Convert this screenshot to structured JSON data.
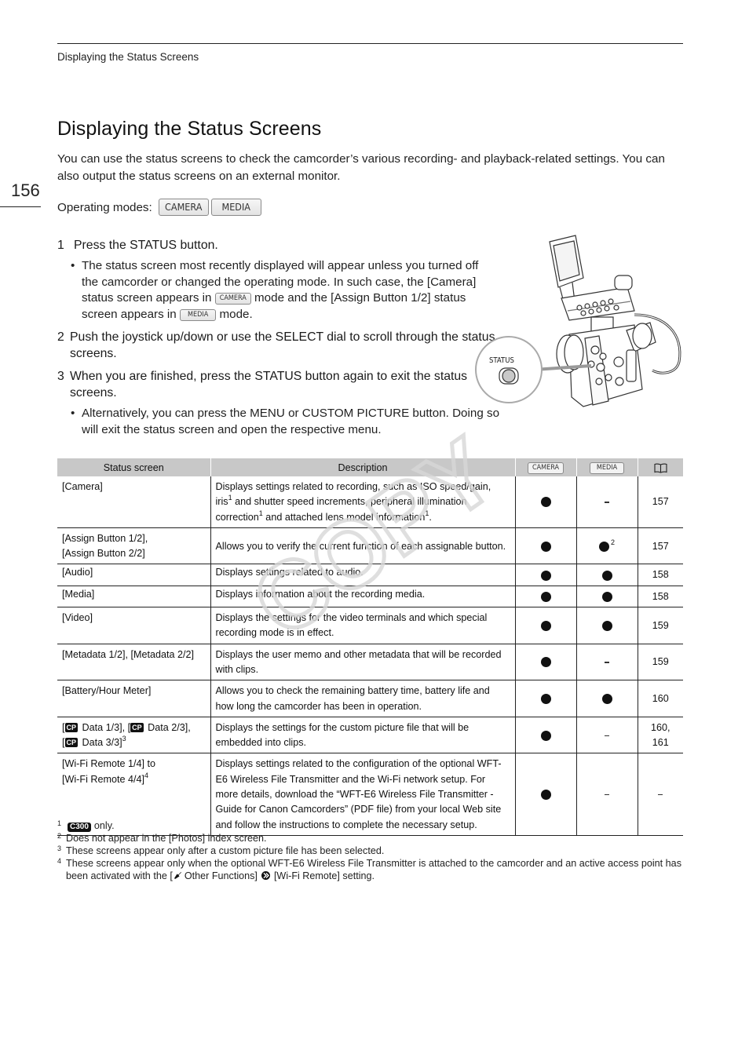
{
  "running_head": "Displaying the Status Screens",
  "page_number": "156",
  "title": "Displaying the Status Screens",
  "intro": "You can use the status screens to check the camcorder’s various recording- and playback-related settings. You can also output the status screens on an external monitor.",
  "operating_modes": {
    "label": "Operating modes:",
    "modes": [
      "CAMERA",
      "MEDIA"
    ]
  },
  "steps": [
    {
      "number": "1",
      "text": "Press the STATUS button.",
      "bullet": {
        "part1": "The status screen most recently displayed will appear unless you turned off the camcorder or changed the operating mode. In such case, the [Camera] status screen appears in",
        "mode1": "CAMERA",
        "part2": "mode and the [Assign Button 1/2] status screen appears in",
        "mode2": "MEDIA",
        "part3": "mode."
      }
    },
    {
      "number": "2",
      "text": "Push the joystick up/down or use the SELECT dial to scroll through the status screens."
    },
    {
      "number": "3",
      "text": "When you are finished, press the STATUS button again to exit the status screens.",
      "bullet": {
        "text": "Alternatively, you can press the MENU or CUSTOM PICTURE button. Doing so will exit the status screen and open the respective menu."
      }
    }
  ],
  "illustration": {
    "callout_label": "STATUS"
  },
  "table": {
    "headers": {
      "status_screen": "Status screen",
      "description": "Description",
      "camera": "CAMERA",
      "media": "MEDIA",
      "page_icon": "book-icon"
    },
    "rows": [
      {
        "screen": "[Camera]",
        "desc_a": "Displays settings related to recording, such as ISO speed/gain, iris",
        "sup_a": "1",
        "desc_b": " and shutter speed increments, peripheral illumination correction",
        "sup_b": "1",
        "desc_c": " and attached lens model information",
        "sup_c": "1",
        "desc_d": ".",
        "camera": "dot",
        "media": "dash",
        "page": "157"
      },
      {
        "screen_line1": "[Assign Button 1/2],",
        "screen_line2": "[Assign Button 2/2]",
        "desc": "Allows you to verify the current function of each assignable button.",
        "camera": "dot",
        "media": "dot",
        "media_sup": "2",
        "page": "157"
      },
      {
        "screen": "[Audio]",
        "desc": "Displays settings related to audio.",
        "camera": "dot",
        "media": "dot",
        "page": "158"
      },
      {
        "screen": "[Media]",
        "desc": "Displays information about the recording media.",
        "camera": "dot",
        "media": "dot",
        "page": "158"
      },
      {
        "screen": "[Video]",
        "desc": "Displays the settings for the video terminals and which special recording mode is in effect.",
        "camera": "dot",
        "media": "dot",
        "page": "159"
      },
      {
        "screen": "[Metadata 1/2], [Metadata 2/2]",
        "desc": "Displays the user memo and other metadata that will be recorded with clips.",
        "camera": "dot",
        "media": "dash",
        "page": "159"
      },
      {
        "screen": "[Battery/Hour Meter]",
        "desc": "Allows you to check the remaining battery time, battery life and how long the camcorder has been in operation.",
        "camera": "dot",
        "media": "dot",
        "page": "160"
      },
      {
        "cp_icon": "CP",
        "screen_a": " Data 1/3], [",
        "screen_b": " Data 2/3],",
        "screen_c": " Data 3/3]",
        "sup": "3",
        "desc": "Displays the settings for the custom picture file that will be embedded into clips.",
        "camera": "dot",
        "media": "dash",
        "page_line1": "160,",
        "page_line2": "161"
      },
      {
        "screen_line1": "[Wi-Fi Remote 1/4] to",
        "screen_line2": "[Wi-Fi Remote 4/4]",
        "sup": "4",
        "desc": "Displays settings related to the configuration of the optional WFT-E6 Wireless File Transmitter and the Wi-Fi network setup. For more details, download the “WFT-E6 Wireless File Transmitter - Guide for Canon Camcorders” (PDF file) from your local Web site and follow the instructions to complete the necessary setup.",
        "camera": "dot",
        "media": "dash",
        "page": "dash"
      }
    ]
  },
  "footnotes": [
    {
      "mark": "1",
      "icon": "C300",
      "text": "only."
    },
    {
      "mark": "2",
      "text": "Does not appear in the [Photos] index screen."
    },
    {
      "mark": "3",
      "text": "These screens appear only after a custom picture file has been selected."
    },
    {
      "mark": "4",
      "text_a": "These screens appear only when the optional WFT-E6 Wireless File Transmitter is attached to the camcorder and an active access point has been activated with the [",
      "menu": "Other Functions]",
      "text_b": "[Wi-Fi Remote] setting."
    }
  ],
  "watermark": "COPY"
}
